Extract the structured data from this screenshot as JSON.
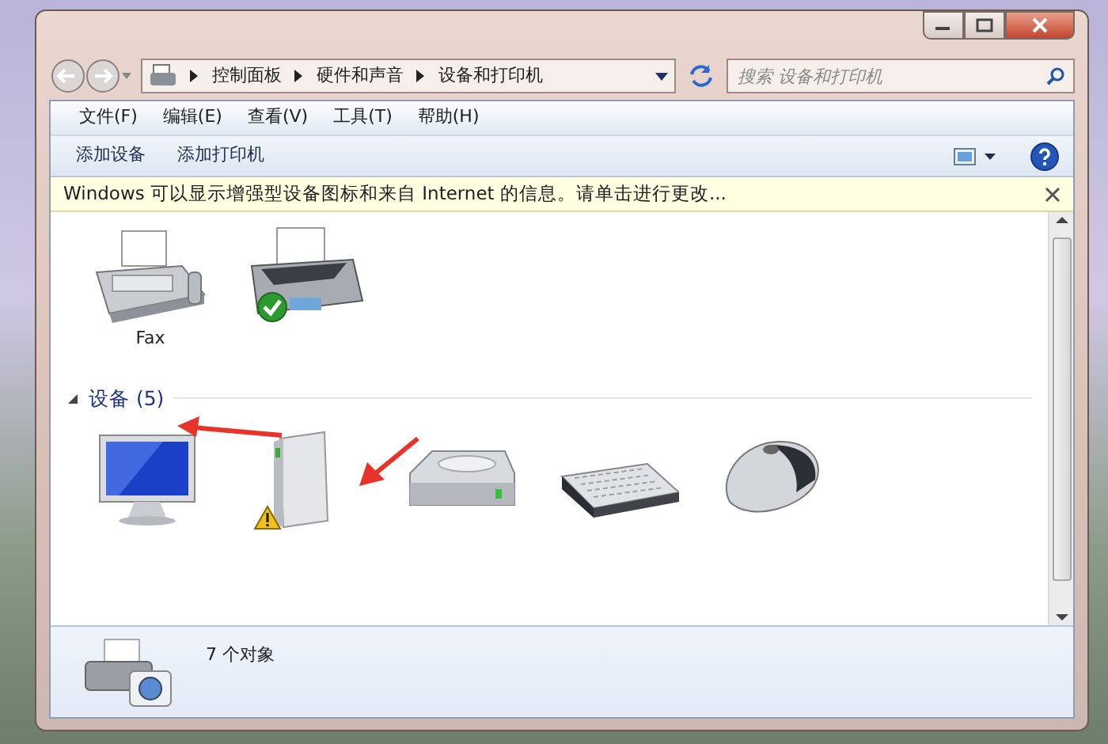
{
  "address_bar": {
    "breadcrumbs": [
      "控制面板",
      "硬件和声音",
      "设备和打印机"
    ]
  },
  "search": {
    "placeholder": "搜索 设备和打印机"
  },
  "menu": [
    "文件(F)",
    "编辑(E)",
    "查看(V)",
    "工具(T)",
    "帮助(H)"
  ],
  "toolbar": [
    "添加设备",
    "添加打印机"
  ],
  "info_bar": {
    "text": "Windows 可以显示增强型设备图标和来自 Internet 的信息。请单击进行更改..."
  },
  "printers": {
    "items": [
      {
        "kind": "fax",
        "label": "Fax",
        "default": false
      },
      {
        "kind": "printer",
        "default": true
      }
    ]
  },
  "devices": {
    "title": "设备 (5)",
    "expanded": true,
    "items": [
      {
        "kind": "monitor",
        "warning": false
      },
      {
        "kind": "tower",
        "warning": true
      },
      {
        "kind": "drive",
        "warning": false
      },
      {
        "kind": "keyboard",
        "warning": false
      },
      {
        "kind": "mouse",
        "warning": false
      }
    ]
  },
  "status_bar": {
    "text": "7 个对象"
  }
}
